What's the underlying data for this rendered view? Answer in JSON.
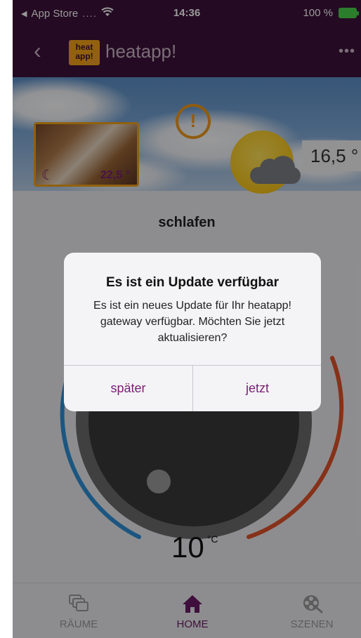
{
  "status_bar": {
    "back_app": "App Store",
    "signal_dots": "....",
    "time": "14:36",
    "battery": "100 %"
  },
  "nav": {
    "title": "heatapp!",
    "logo_top": "heat",
    "logo_bottom": "app!"
  },
  "room": {
    "temperature": "22,5 °",
    "outside_temperature": "16,5 °",
    "mode": "schlafen"
  },
  "thermostat": {
    "set_temperature": "10",
    "unit": "°C"
  },
  "dialog": {
    "title": "Es ist ein Update verfügbar",
    "message": "Es ist ein neues Update für Ihr heatapp! gateway verfügbar. Möchten Sie jetzt aktualisieren?",
    "later_button": "später",
    "now_button": "jetzt"
  },
  "tabs": {
    "raeume": "RÄUME",
    "home": "HOME",
    "szenen": "SZENEN"
  },
  "colors": {
    "brand": "#3d1139",
    "accent": "#7a1e74",
    "logo": "#f3a21a",
    "warning": "#f09a1a",
    "dial_cold": "#2f8fd6",
    "dial_warm": "#e0532a"
  }
}
